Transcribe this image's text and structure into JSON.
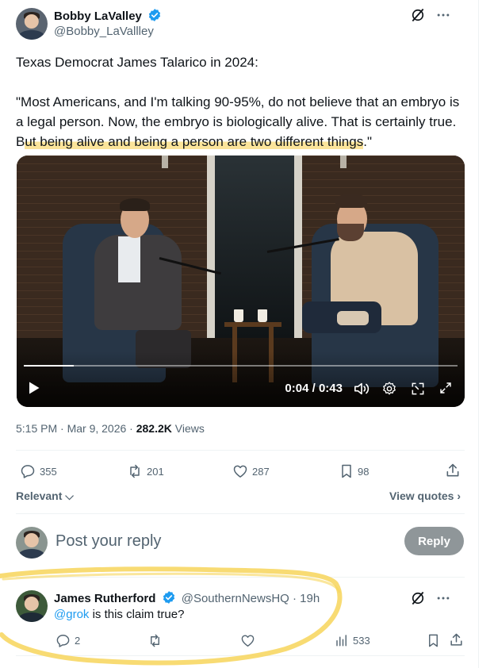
{
  "post": {
    "author_name": "Bobby LaValley",
    "author_handle": "@Bobby_LaVallley",
    "text_intro": "Texas Democrat James Talarico in 2024:",
    "quote_before": "\"Most Americans, and I'm talking 90-95%, do not believe that an embryo is a legal person. Now, the embryo is biologically alive. That is certainly true. B",
    "quote_highlight": "ut being alive and being a person are two different things",
    "quote_after": ".\"",
    "timestamp": "5:15 PM · Mar 9, 2026 · ",
    "views_count": "282.2K",
    "views_label": " Views"
  },
  "video": {
    "current_time": "0:04",
    "separator": " / ",
    "duration": "0:43",
    "progress": 0.115
  },
  "actions": {
    "replies": "355",
    "reposts": "201",
    "likes": "287",
    "bookmarks": "98"
  },
  "sort": {
    "relevant_label": "Relevant",
    "view_quotes_label": "View quotes"
  },
  "compose": {
    "placeholder": "Post your reply",
    "reply_label": "Reply"
  },
  "reply": {
    "author_name": "James Rutherford",
    "author_handle": "@SouthernNewsHQ · 19h",
    "mention": "@grok",
    "text": " is this claim true?",
    "reply_count": "2",
    "views_count": "533"
  },
  "colors": {
    "verified": "#1d9bf0",
    "highlight": "#fbe49a",
    "annotation": "#f7d55a",
    "reply_button": "#8f9699"
  }
}
